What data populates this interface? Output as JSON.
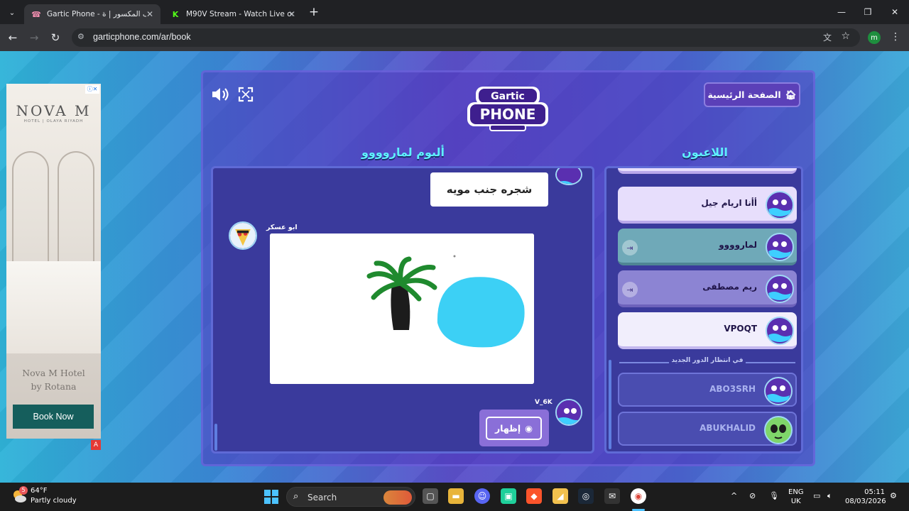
{
  "browser": {
    "tabs": [
      {
        "title": "Gartic Phone - الهاتف المكسور | ة",
        "icon": "phone-icon",
        "active": true
      },
      {
        "title": "M90V Stream - Watch Live on K",
        "icon": "kick-icon",
        "active": false
      }
    ],
    "url": "garticphone.com/ar/book",
    "profile_initial": "m"
  },
  "ad": {
    "brand": "NOVA M",
    "sub": "HOTEL | OLAYA RIYADH",
    "hotel_line1": "Nova M Hotel",
    "hotel_line2": "by Rotana",
    "cta": "Book Now",
    "corner": "A"
  },
  "game": {
    "home_label": "الصفحة الرئيسية",
    "album_title": "ألبوم لماروووو",
    "players_title": "اللاعبون",
    "album": {
      "prompt_text": "شجره جنب مويه",
      "drawer_name": "ابو عسكر",
      "next_player_name": "V_6K",
      "show_label": "إظهار"
    },
    "players": [
      {
        "name": "أأنا اريام جيل",
        "style": "light",
        "kick": false
      },
      {
        "name": "لماروووو",
        "style": "teal",
        "kick": true
      },
      {
        "name": "ريم مصطفى",
        "style": "dim",
        "kick": true
      },
      {
        "name": "VPOQT",
        "style": "white",
        "kick": false
      }
    ],
    "waiting_label": "في انتظار الدور الجديد",
    "waiting_players": [
      {
        "name": "ABO3SRH"
      },
      {
        "name": "ABUKHALID"
      }
    ]
  },
  "taskbar": {
    "weather_temp": "64°F",
    "weather_desc": "Partly cloudy",
    "weather_badge": "5",
    "search_label": "Search",
    "lang_line1": "ENG",
    "lang_line2": "UK",
    "time": "05:11",
    "date": "08/03/2026"
  },
  "colors": {
    "accent_title": "#5ff0ff",
    "panel": "#3a3a9c",
    "ad_button": "#155e5c"
  }
}
